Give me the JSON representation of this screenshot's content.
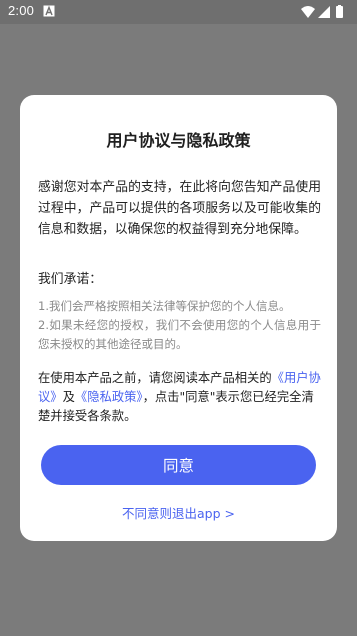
{
  "status_bar": {
    "time": "2:00",
    "icons": [
      "a-icon",
      "wifi-icon",
      "signal-icon",
      "battery-icon"
    ]
  },
  "dialog": {
    "title": "用户协议与隐私政策",
    "intro": "感谢您对本产品的支持，在此将向您告知产品使用过程中，产品可以提供的各项服务以及可能收集的信息和数据，以确保您的权益得到充分地保障。",
    "promise_heading": "我们承诺：",
    "promises": [
      "1.我们会严格按照相关法律等保护您的个人信息。",
      "2.如果未经您的授权，我们不会使用您的个人信息用于您未授权的其他途径或目的。"
    ],
    "notice": {
      "prefix": "在使用本产品之前，请您阅读本产品相关的",
      "user_agreement_link": "《用户协议》",
      "and": "及",
      "privacy_policy_link": "《隐私政策》",
      "suffix": "，点击\"同意\"表示您已经完全清楚并接受各条款。"
    },
    "agree_button": "同意",
    "exit_link": "不同意则退出app >"
  }
}
